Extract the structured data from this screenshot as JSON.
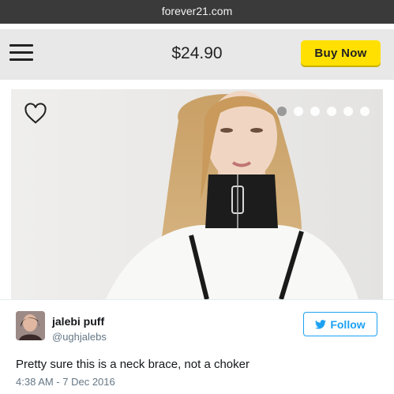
{
  "browser": {
    "url": "forever21.com"
  },
  "header": {
    "price": "$24.90",
    "buy_label": "Buy Now"
  },
  "product": {
    "image_count": 6,
    "active_image_index": 0
  },
  "tweet": {
    "name": "jalebi puff",
    "handle": "@ughjalebs",
    "follow_label": "Follow",
    "text": "Pretty sure this is a neck brace, not a choker",
    "timestamp": "4:38 AM - 7 Dec 2016"
  },
  "colors": {
    "buy_button": "#ffe000",
    "twitter_blue": "#1da1f2",
    "navbar": "#e8e8e8",
    "urlbar": "#3a3a3a"
  },
  "icons": {
    "menu": "hamburger-icon",
    "favorite": "heart-icon",
    "follow": "twitter-bird-icon"
  }
}
